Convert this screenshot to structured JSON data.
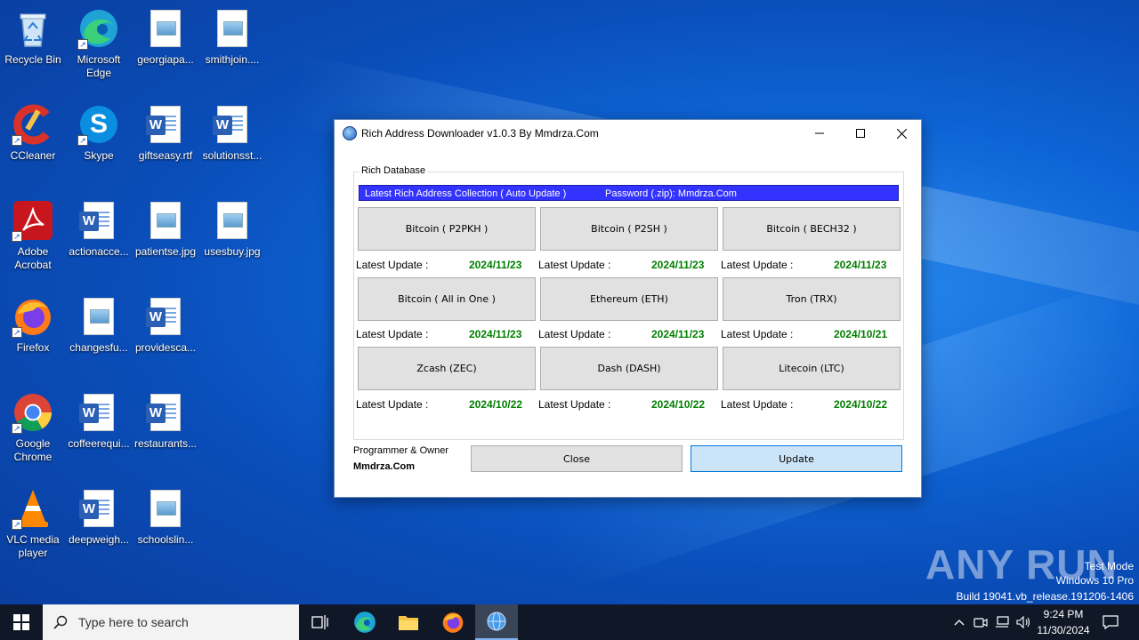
{
  "desktop": {
    "icons": [
      {
        "label": "Recycle Bin"
      },
      {
        "label": "Microsoft Edge"
      },
      {
        "label": "georgiapa..."
      },
      {
        "label": "smithjoin...."
      },
      {
        "label": "CCleaner"
      },
      {
        "label": "Skype"
      },
      {
        "label": "giftseasy.rtf"
      },
      {
        "label": "solutionsst..."
      },
      {
        "label": "Adobe Acrobat"
      },
      {
        "label": "actionacce..."
      },
      {
        "label": "patientse.jpg"
      },
      {
        "label": "usesbuy.jpg"
      },
      {
        "label": "Firefox"
      },
      {
        "label": "changesfu..."
      },
      {
        "label": "providesca..."
      },
      {
        "label": "Google Chrome"
      },
      {
        "label": "coffeerequi..."
      },
      {
        "label": "restaurants..."
      },
      {
        "label": "VLC media player"
      },
      {
        "label": "deepweigh..."
      },
      {
        "label": "schoolslin..."
      }
    ]
  },
  "window": {
    "title": "Rich Address Downloader v1.0.3 By Mmdrza.Com",
    "group_label": "Rich Database",
    "banner_left": "Latest Rich Address Collection ( Auto Update )",
    "banner_right": "Password (.zip): Mmdrza.Com",
    "update_label": "Latest Update :",
    "coins": [
      {
        "label": "Bitcoin ( P2PKH )",
        "date": "2024/11/23"
      },
      {
        "label": "Bitcoin ( P2SH )",
        "date": "2024/11/23"
      },
      {
        "label": "Bitcoin ( BECH32 )",
        "date": "2024/11/23"
      },
      {
        "label": "Bitcoin ( All in One )",
        "date": "2024/11/23"
      },
      {
        "label": "Ethereum (ETH)",
        "date": "2024/11/23"
      },
      {
        "label": "Tron (TRX)",
        "date": "2024/10/21"
      },
      {
        "label": "Zcash (ZEC)",
        "date": "2024/10/22"
      },
      {
        "label": "Dash (DASH)",
        "date": "2024/10/22"
      },
      {
        "label": "Litecoin (LTC)",
        "date": "2024/10/22"
      }
    ],
    "programmer_label": "Programmer & Owner",
    "programmer_name": "Mmdrza.Com",
    "close_label": "Close",
    "update_button": "Update"
  },
  "watermark": {
    "logo": "ANY RUN",
    "line1": "Test Mode",
    "line2": "Windows 10 Pro",
    "line3": "Build 19041.vb_release.191206-1406"
  },
  "taskbar": {
    "search_placeholder": "Type here to search",
    "time": "9:24 PM",
    "date": "11/30/2024"
  },
  "colors": {
    "banner": "#3333ff",
    "date_green": "#008000",
    "update_button_bg": "#cce4f7",
    "taskbar": "#101828"
  }
}
